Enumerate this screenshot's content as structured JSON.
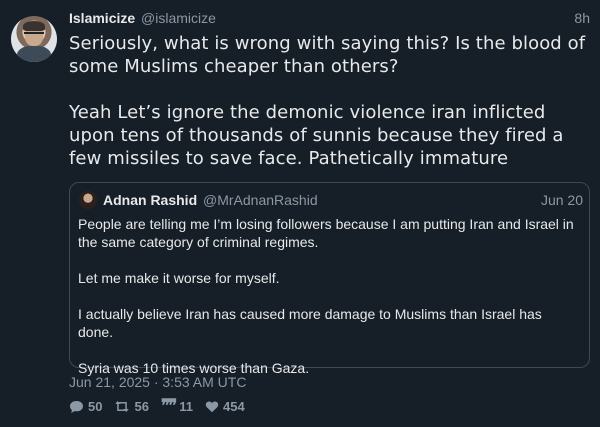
{
  "tweet": {
    "display_name": "Islamicize",
    "handle": "@islamicize",
    "time": "8h",
    "paragraphs": [
      "Seriously, what is wrong with saying this? Is the blood of some Muslims cheaper than others?",
      "Yeah Let’s ignore the demonic violence iran inflicted upon tens of thousands of sunnis because they fired a few missiles to save face. Pathetically immature"
    ],
    "timestamp": "Jun 21, 2025 · 3:53 AM UTC"
  },
  "quoted": {
    "display_name": "Adnan Rashid",
    "handle": "@MrAdnanRashid",
    "date": "Jun 20",
    "paragraphs": [
      "People are telling me I’m losing followers because I am putting Iran and Israel in the same category of criminal regimes.",
      "Let me make it worse for myself.",
      "I actually believe Iran has caused more damage to Muslims than Israel has done.",
      "Syria was 10 times worse than Gaza."
    ]
  },
  "stats": {
    "replies": "50",
    "retweets": "56",
    "quotes": "11",
    "likes": "454"
  },
  "icons": {
    "reply": "comment-icon",
    "retweet": "retweet-icon",
    "quote": "quote-icon",
    "like": "heart-icon"
  },
  "colors": {
    "background": "#161e27",
    "text": "#e7e9ea",
    "muted": "#8b98a5",
    "border": "#3d4954"
  }
}
